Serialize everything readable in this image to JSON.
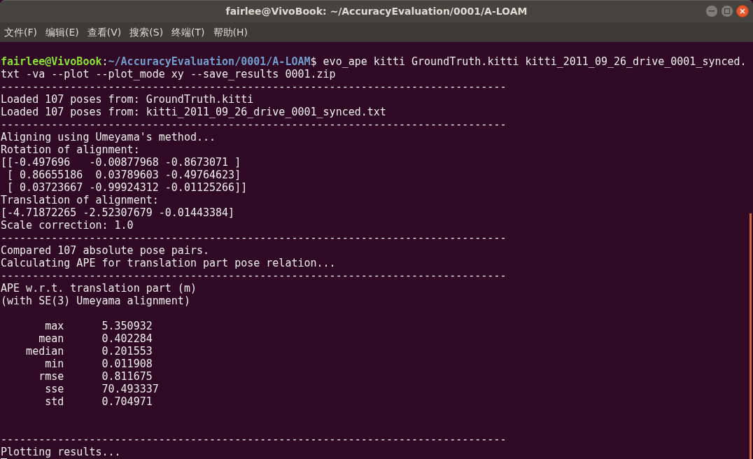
{
  "window": {
    "title": "fairlee@VivoBook: ~/AccuracyEvaluation/0001/A-LOAM"
  },
  "menu": [
    "文件(F)",
    "编辑(E)",
    "查看(V)",
    "搜索(S)",
    "终端(T)",
    "帮助(H)"
  ],
  "terminal": {
    "lines": [
      {
        "kind": "blank"
      },
      {
        "kind": "prompt",
        "user_host": "fairlee@VivoBook",
        "separator": ":",
        "path": "~/AccuracyEvaluation/0001/A-LOAM",
        "command": "$ evo_ape kitti GroundTruth.kitti kitti_2011_09_26_drive_0001_synced."
      },
      {
        "kind": "output",
        "text": "txt -va --plot --plot_mode xy --save_results 0001.zip"
      },
      {
        "kind": "output",
        "text": "--------------------------------------------------------------------------------"
      },
      {
        "kind": "output",
        "text": "Loaded 107 poses from: GroundTruth.kitti"
      },
      {
        "kind": "output",
        "text": "Loaded 107 poses from: kitti_2011_09_26_drive_0001_synced.txt"
      },
      {
        "kind": "output",
        "text": "--------------------------------------------------------------------------------"
      },
      {
        "kind": "output",
        "text": "Aligning using Umeyama's method..."
      },
      {
        "kind": "output",
        "text": "Rotation of alignment:"
      },
      {
        "kind": "output",
        "text": "[[-0.497696   -0.00877968 -0.8673071 ]"
      },
      {
        "kind": "output",
        "text": " [ 0.86655186  0.03789603 -0.49764623]"
      },
      {
        "kind": "output",
        "text": " [ 0.03723667 -0.99924312 -0.01125266]]"
      },
      {
        "kind": "output",
        "text": "Translation of alignment:"
      },
      {
        "kind": "output",
        "text": "[-4.71872265 -2.52307679 -0.01443384]"
      },
      {
        "kind": "output",
        "text": "Scale correction: 1.0"
      },
      {
        "kind": "output",
        "text": "--------------------------------------------------------------------------------"
      },
      {
        "kind": "output",
        "text": "Compared 107 absolute pose pairs."
      },
      {
        "kind": "output",
        "text": "Calculating APE for translation part pose relation..."
      },
      {
        "kind": "output",
        "text": "--------------------------------------------------------------------------------"
      },
      {
        "kind": "output",
        "text": "APE w.r.t. translation part (m)"
      },
      {
        "kind": "output",
        "text": "(with SE(3) Umeyama alignment)"
      },
      {
        "kind": "blank"
      },
      {
        "kind": "output",
        "text": "       max      5.350932"
      },
      {
        "kind": "output",
        "text": "      mean      0.402284"
      },
      {
        "kind": "output",
        "text": "    median      0.201553"
      },
      {
        "kind": "output",
        "text": "       min      0.011908"
      },
      {
        "kind": "output",
        "text": "      rmse      0.811675"
      },
      {
        "kind": "output",
        "text": "       sse      70.493337"
      },
      {
        "kind": "output",
        "text": "       std      0.704971"
      },
      {
        "kind": "blank"
      },
      {
        "kind": "blank"
      },
      {
        "kind": "output",
        "text": "--------------------------------------------------------------------------------"
      },
      {
        "kind": "output",
        "text": "Plotting results..."
      },
      {
        "kind": "cursor"
      }
    ]
  }
}
